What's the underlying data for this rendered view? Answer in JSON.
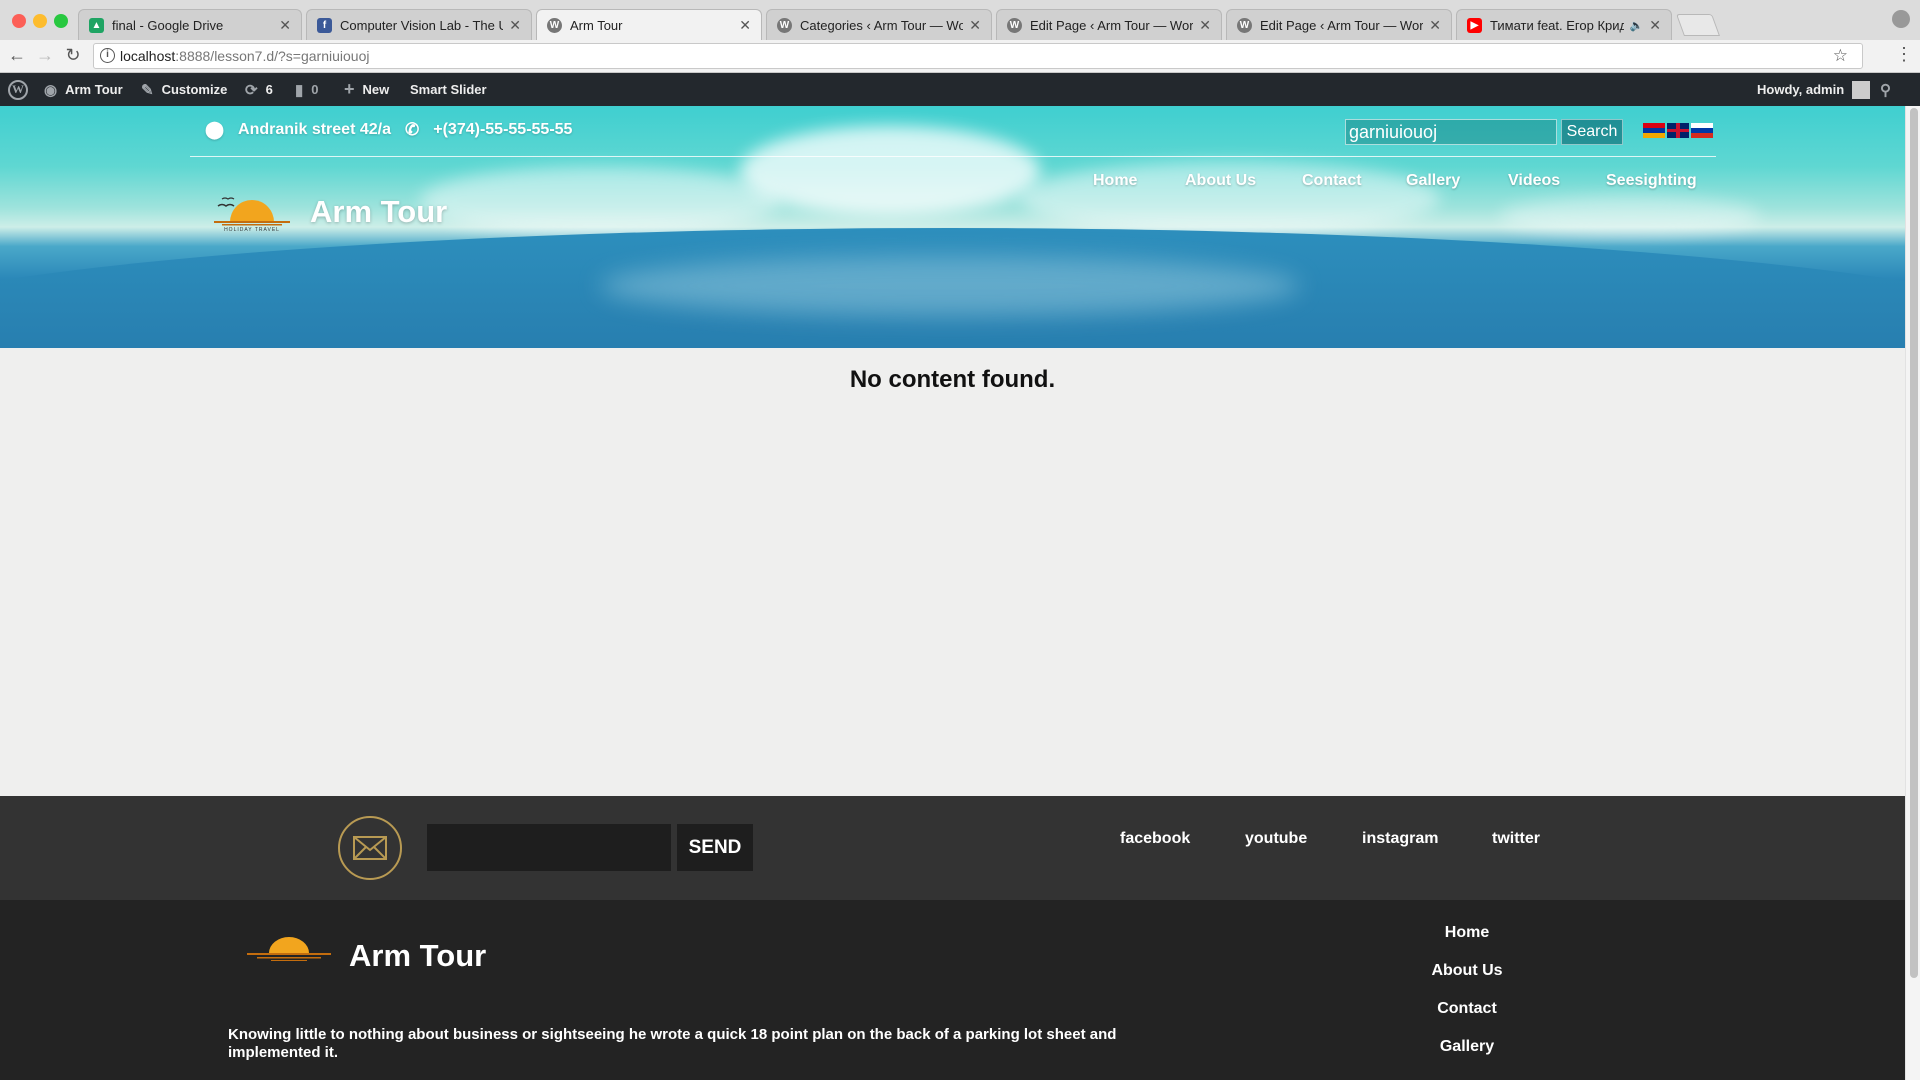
{
  "browser": {
    "tabs": [
      {
        "title": "final - Google Drive",
        "icon": "google-drive-icon",
        "color": "#1fa463",
        "active": false
      },
      {
        "title": "Computer Vision Lab - The Un",
        "icon": "facebook-icon",
        "color": "#3b5998",
        "active": false
      },
      {
        "title": "Arm Tour",
        "icon": "wordpress-icon",
        "color": "#777777",
        "active": true
      },
      {
        "title": "Categories ‹ Arm Tour — Word",
        "icon": "wordpress-icon",
        "color": "#777777",
        "active": false
      },
      {
        "title": "Edit Page ‹ Arm Tour — WordP",
        "icon": "wordpress-icon",
        "color": "#777777",
        "active": false
      },
      {
        "title": "Edit Page ‹ Arm Tour — WordP",
        "icon": "wordpress-icon",
        "color": "#777777",
        "active": false
      },
      {
        "title": "Тимати feat. Егор Крид - Г",
        "icon": "youtube-icon",
        "color": "#ff0000",
        "active": false
      }
    ],
    "url_host": "localhost",
    "url_rest": ":8888/lesson7.d/?s=garniuiouoj"
  },
  "admin_bar": {
    "site_name": "Arm Tour",
    "customize": "Customize",
    "updates_count": "6",
    "comments_count": "0",
    "new_label": "New",
    "smart_slider": "Smart Slider",
    "howdy": "Howdy, admin"
  },
  "header": {
    "address": "Andranik street 42/a",
    "phone": "+(374)-55-55-55-55",
    "search_value": "garniuiouoj",
    "search_button": "Search",
    "languages": [
      "hy",
      "en",
      "ru"
    ],
    "nav": [
      "Home",
      "About Us",
      "Contact",
      "Gallery",
      "Videos",
      "Seesighting"
    ],
    "site_title": "Arm Tour",
    "logo_text": "HOLIDAY TRAVEL"
  },
  "main": {
    "message": "No content found."
  },
  "footer": {
    "send_label": "SEND",
    "email_value": "",
    "social": [
      "facebook",
      "youtube",
      "instagram",
      "twitter"
    ],
    "brand": "Arm Tour",
    "description": "Knowing little to nothing about business or sightseeing he wrote a quick 18 point plan on the back of a parking lot sheet and implemented it.",
    "nav": [
      "Home",
      "About Us",
      "Contact",
      "Gallery"
    ]
  },
  "colors": {
    "admin_bar": "#23282d",
    "footer_top": "#333333",
    "footer_bottom": "#232323",
    "accent_gold": "#b89a53"
  }
}
